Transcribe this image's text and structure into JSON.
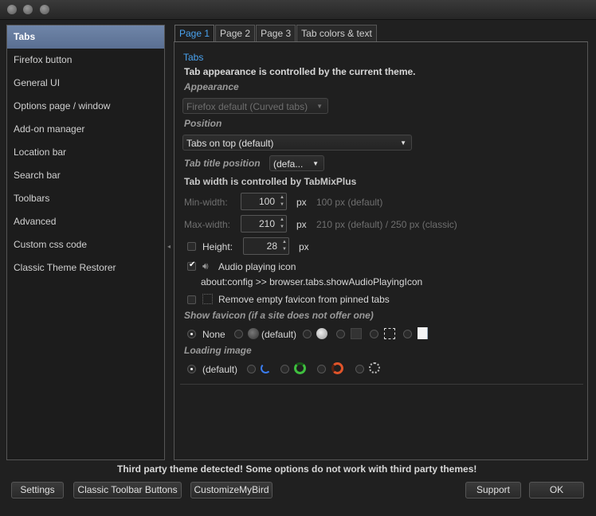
{
  "sidebar": {
    "items": [
      {
        "label": "Tabs",
        "selected": true
      },
      {
        "label": "Firefox button"
      },
      {
        "label": "General UI"
      },
      {
        "label": "Options page / window"
      },
      {
        "label": "Add-on manager"
      },
      {
        "label": "Location bar"
      },
      {
        "label": "Search bar"
      },
      {
        "label": "Toolbars"
      },
      {
        "label": "Advanced"
      },
      {
        "label": "Custom css code"
      },
      {
        "label": "Classic Theme Restorer"
      }
    ]
  },
  "tabs": [
    "Page 1",
    "Page 2",
    "Page 3",
    "Tab colors & text"
  ],
  "content": {
    "section_title": "Tabs",
    "appearance_note": "Tab appearance is controlled by the current theme.",
    "appearance_label": "Appearance",
    "appearance_value": "Firefox default (Curved tabs)",
    "position_label": "Position",
    "position_value": "Tabs on top (default)",
    "tab_title_position_label": "Tab title position",
    "tab_title_position_value": "(defa...",
    "tab_width_note": "Tab width is controlled by TabMixPlus",
    "min_width_label": "Min-width:",
    "min_width_value": "100",
    "min_width_unit": "px",
    "min_width_hint": "100 px (default)",
    "max_width_label": "Max-width:",
    "max_width_value": "210",
    "max_width_unit": "px",
    "max_width_hint": "210 px (default) / 250 px (classic)",
    "height_label": "Height:",
    "height_value": "28",
    "height_unit": "px",
    "height_checked": false,
    "audio_label": "Audio playing icon",
    "audio_checked": true,
    "audio_hint": "about:config >> browser.tabs.showAudioPlayingIcon",
    "remove_favicon_label": "Remove empty favicon from pinned tabs",
    "remove_favicon_checked": false,
    "favicon_label": "Show favicon (if a site does not offer one)",
    "favicon_none": "None",
    "favicon_default": "(default)",
    "loading_label": "Loading image",
    "loading_default": "(default)"
  },
  "footer": {
    "warning": "Third party theme detected! Some options do not work with third party themes!",
    "settings": "Settings",
    "classic_toolbar": "Classic Toolbar Buttons",
    "customize": "CustomizeMyBird",
    "support": "Support",
    "ok": "OK"
  },
  "colors": {
    "accent": "#4aa3f0",
    "selection": "#6377a0",
    "background": "#202020"
  },
  "icons": {
    "audio": "speaker-icon",
    "globe": "globe-icon",
    "document": "document-icon",
    "spinner_blue": "loading-blue-icon",
    "spinner_green": "loading-green-icon",
    "spinner_orange": "loading-orange-icon",
    "spinner_dots": "loading-dots-icon"
  }
}
